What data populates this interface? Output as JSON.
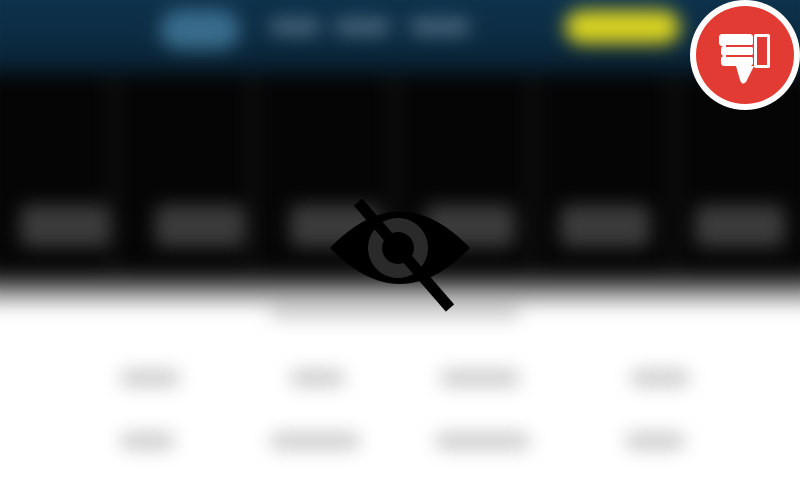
{
  "overlay": {
    "icon": "eye-slash-icon",
    "state": "content hidden"
  },
  "badge": {
    "icon": "thumbs-down-icon",
    "color": "#e23b33"
  },
  "colors": {
    "header_bg": "#0f3550",
    "cta": "#d8d222",
    "hero_bg": "#050505",
    "content_bg": "#ffffff"
  }
}
